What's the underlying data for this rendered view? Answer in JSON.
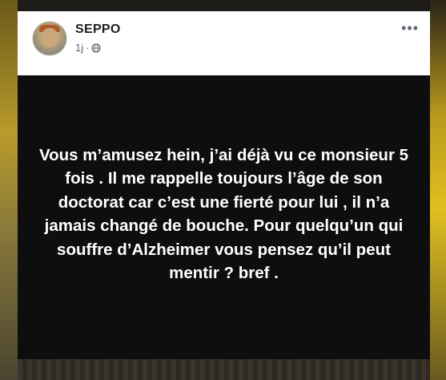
{
  "post": {
    "author": "SEPPO",
    "time": "1j",
    "separator": "·",
    "privacy_icon": "globe-icon",
    "more_icon": "ellipsis-icon",
    "text": "Vous m’amusez hein, j’ai déjà vu ce monsieur 5 fois . Il me rappelle toujours l’âge de son doctorat car c’est une fierté pour lui , il n’a jamais changé de bouche. Pour quelqu’un qui souffre d’Alzheimer vous pensez qu’il peut mentir ? bref .",
    "background_color": "#0e0e0e",
    "text_color": "#ffffff"
  }
}
